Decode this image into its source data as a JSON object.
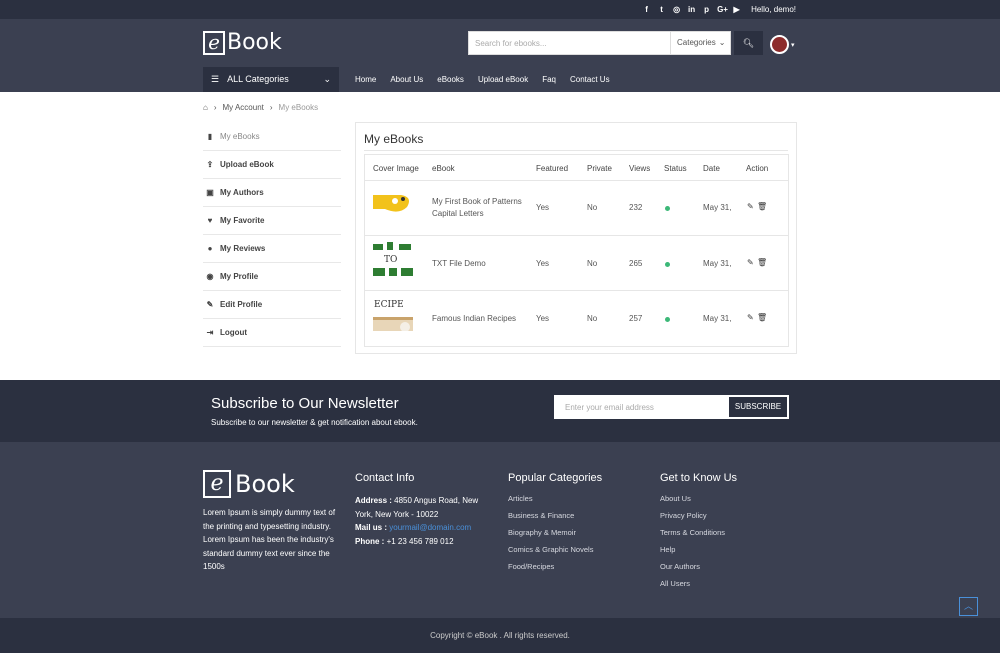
{
  "topbar": {
    "social_icons": [
      "facebook-icon",
      "twitter-icon",
      "instagram-icon",
      "linkedin-icon",
      "pinterest-icon",
      "google-plus-icon",
      "youtube-icon"
    ],
    "greeting": "Hello, demo!"
  },
  "header": {
    "logo_text": "Book",
    "logo_letter": "e",
    "search_placeholder": "Search for ebooks...",
    "categories_label": "Categories",
    "all_categories_label": "ALL Categories",
    "nav": [
      "Home",
      "About Us",
      "eBooks",
      "Upload eBook",
      "Faq",
      "Contact Us"
    ]
  },
  "breadcrumb": {
    "items": [
      "My Account",
      "My eBooks"
    ]
  },
  "sidebar": {
    "items": [
      {
        "label": "My eBooks",
        "icon": "book-icon"
      },
      {
        "label": "Upload eBook",
        "icon": "upload-icon"
      },
      {
        "label": "My Authors",
        "icon": "author-icon"
      },
      {
        "label": "My Favorite",
        "icon": "heart-icon"
      },
      {
        "label": "My Reviews",
        "icon": "comment-icon"
      },
      {
        "label": "My Profile",
        "icon": "user-circle-icon"
      },
      {
        "label": "Edit Profile",
        "icon": "edit-icon"
      },
      {
        "label": "Logout",
        "icon": "logout-icon"
      }
    ]
  },
  "main": {
    "title": "My eBooks",
    "columns": [
      "Cover Image",
      "eBook",
      "Featured",
      "Private",
      "Views",
      "Status",
      "Date",
      "Action"
    ],
    "rows": [
      {
        "ebook": "My First Book of Patterns Capital Letters",
        "featured": "Yes",
        "private": "No",
        "views": "232",
        "date": "May 31,"
      },
      {
        "ebook": "TXT File Demo",
        "featured": "Yes",
        "private": "No",
        "views": "265",
        "date": "May 31,"
      },
      {
        "ebook": "Famous Indian Recipes",
        "featured": "Yes",
        "private": "No",
        "views": "257",
        "date": "May 31,"
      }
    ],
    "status_color": "#3cb878"
  },
  "newsletter": {
    "heading": "Subscribe to Our Newsletter",
    "subtext": "Subscribe to our newsletter & get notification about ebook.",
    "placeholder": "Enter your email address",
    "button": "SUBSCRIBE"
  },
  "footer": {
    "about": "Lorem Ipsum is simply dummy text of the printing and typesetting industry. Lorem Ipsum has been the industry's standard dummy text ever since the 1500s",
    "contact_heading": "Contact Info",
    "address_label": "Address :",
    "address": "4850 Angus Road, New York, New York - 10022",
    "mail_label": "Mail us :",
    "mail": "yourmail@domain.com",
    "phone_label": "Phone :",
    "phone": "+1 23 456 789 012",
    "categories_heading": "Popular Categories",
    "categories": [
      "Articles",
      "Business & Finance",
      "Biography & Memoir",
      "Comics & Graphic Novels",
      "Food/Recipes"
    ],
    "know_heading": "Get to Know Us",
    "know": [
      "About Us",
      "Privacy Policy",
      "Terms & Conditions",
      "Help",
      "Our Authors",
      "All Users"
    ],
    "copyright": "Copyright © eBook . All rights reserved."
  },
  "colors": {
    "dark": "#2b3040",
    "header": "#3b4051",
    "accent": "#4a90d9"
  }
}
